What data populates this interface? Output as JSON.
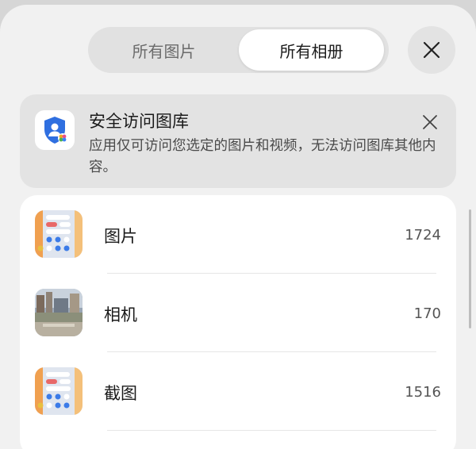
{
  "tabs": [
    {
      "label": "所有图片",
      "selected": false
    },
    {
      "label": "所有相册",
      "selected": true
    }
  ],
  "header": {
    "close_icon": "close-icon"
  },
  "banner": {
    "icon": "shield-user-icon",
    "title": "安全访问图库",
    "description": "应用仅可访问您选定的图片和视频，无法访问图库其他内容。",
    "close_icon": "close-icon"
  },
  "albums": [
    {
      "name": "图片",
      "count": "1724",
      "thumb": "screenshot-thumbnail"
    },
    {
      "name": "相机",
      "count": "170",
      "thumb": "photo-thumbnail"
    },
    {
      "name": "截图",
      "count": "1516",
      "thumb": "screenshot-thumbnail"
    }
  ],
  "colors": {
    "accent_blue": "#2f6fe0",
    "sheet_bg": "#f1f1f1",
    "card_bg": "#ffffff"
  }
}
